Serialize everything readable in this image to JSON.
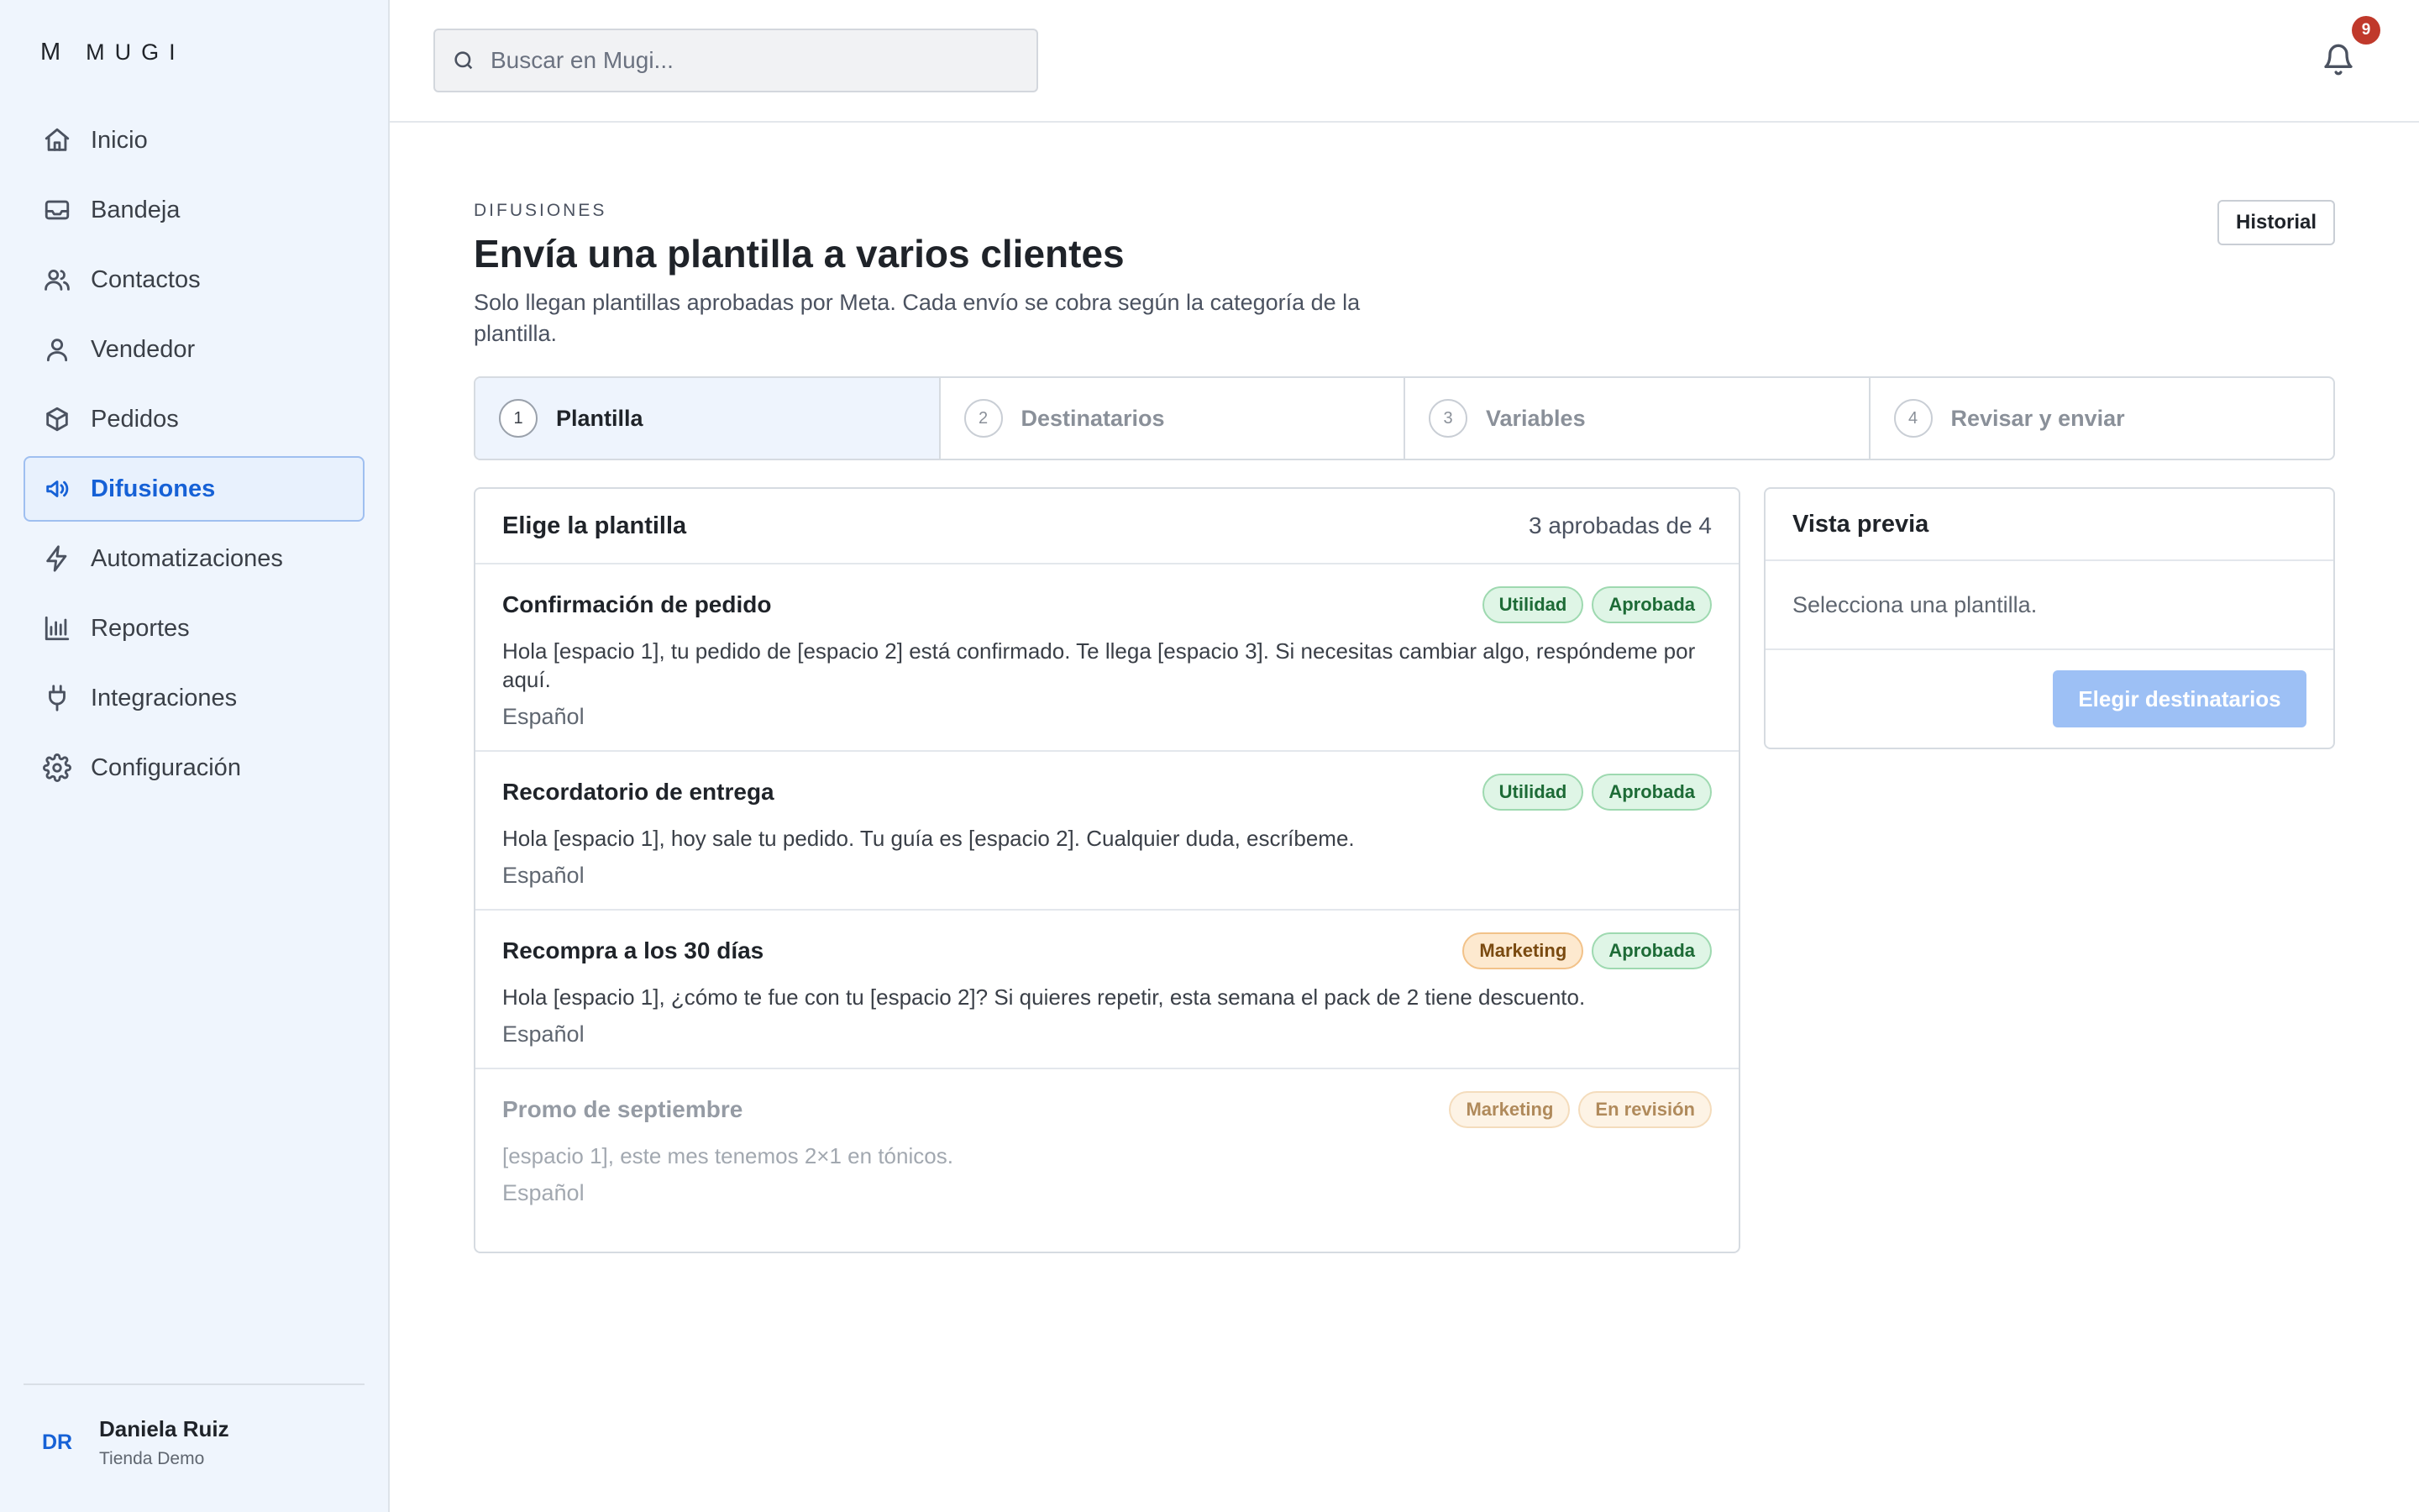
{
  "brand": {
    "mark": "M",
    "name": "MUGI"
  },
  "sidebar": {
    "items": [
      {
        "label": "Inicio",
        "icon": "home-icon"
      },
      {
        "label": "Bandeja",
        "icon": "inbox-icon"
      },
      {
        "label": "Contactos",
        "icon": "users-icon"
      },
      {
        "label": "Vendedor",
        "icon": "user-icon"
      },
      {
        "label": "Pedidos",
        "icon": "package-icon"
      },
      {
        "label": "Difusiones",
        "icon": "megaphone-icon",
        "active": true
      },
      {
        "label": "Automatizaciones",
        "icon": "bolt-icon"
      },
      {
        "label": "Reportes",
        "icon": "bar-chart-icon"
      },
      {
        "label": "Integraciones",
        "icon": "plug-icon"
      },
      {
        "label": "Configuración",
        "icon": "gear-icon"
      }
    ],
    "user": {
      "initials": "DR",
      "name": "Daniela Ruiz",
      "store": "Tienda Demo"
    }
  },
  "topbar": {
    "search_placeholder": "Buscar en Mugi...",
    "notifications_count": "9"
  },
  "page": {
    "eyebrow": "DIFUSIONES",
    "title": "Envía una plantilla a varios clientes",
    "subtitle": "Solo llegan plantillas aprobadas por Meta. Cada envío se cobra según la categoría de la plantilla.",
    "history_button": "Historial"
  },
  "steps": [
    {
      "num": "1",
      "label": "Plantilla",
      "active": true
    },
    {
      "num": "2",
      "label": "Destinatarios"
    },
    {
      "num": "3",
      "label": "Variables"
    },
    {
      "num": "4",
      "label": "Revisar y enviar"
    }
  ],
  "templates": {
    "heading": "Elige la plantilla",
    "count": "3 aprobadas de 4",
    "items": [
      {
        "name": "Confirmación de pedido",
        "category": "Utilidad",
        "status": "Aprobada",
        "body": "Hola [espacio 1], tu pedido de [espacio 2] está confirmado. Te llega [espacio 3]. Si necesitas cambiar algo, respóndeme por aquí.",
        "language": "Español"
      },
      {
        "name": "Recordatorio de entrega",
        "category": "Utilidad",
        "status": "Aprobada",
        "body": "Hola [espacio 1], hoy sale tu pedido. Tu guía es [espacio 2]. Cualquier duda, escríbeme.",
        "language": "Español"
      },
      {
        "name": "Recompra a los 30 días",
        "category": "Marketing",
        "status": "Aprobada",
        "body": "Hola [espacio 1], ¿cómo te fue con tu [espacio 2]? Si quieres repetir, esta semana el pack de 2 tiene descuento.",
        "language": "Español"
      },
      {
        "name": "Promo de septiembre",
        "category": "Marketing",
        "status": "En revisión",
        "body": "[espacio 1], este mes tenemos 2×1 en tónicos.",
        "language": "Español"
      }
    ]
  },
  "preview": {
    "heading": "Vista previa",
    "empty_text": "Selecciona una plantilla.",
    "next_button": "Elegir destinatarios"
  }
}
